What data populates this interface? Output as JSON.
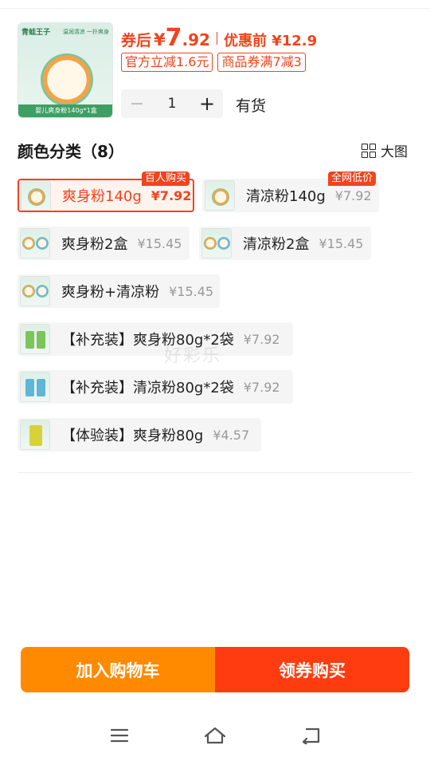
{
  "product": {
    "thumb_brand": "青蛙王子",
    "thumb_tag": "温润清凉 一扑爽身",
    "thumb_caption": "婴儿爽身粉140g*1盒",
    "after_coupon_label": "券后",
    "currency": "¥",
    "price_int": "7",
    "price_dec": ".92",
    "before_label": "优惠前 ¥12.9",
    "coupons": [
      "官方立减1.6元",
      "商品券满7减3"
    ],
    "quantity": "1",
    "stock": "有货"
  },
  "section": {
    "title": "颜色分类（8）",
    "view_label": "大图"
  },
  "options": [
    {
      "name": "爽身粉140g",
      "price": "¥7.92",
      "badge": "百人购买",
      "selected": true
    },
    {
      "name": "清凉粉140g",
      "price": "¥7.92",
      "badge": "全网低价",
      "selected": false
    },
    {
      "name": "爽身粉2盒",
      "price": "¥15.45",
      "badge": "",
      "selected": false
    },
    {
      "name": "清凉粉2盒",
      "price": "¥15.45",
      "badge": "",
      "selected": false
    },
    {
      "name": "爽身粉+清凉粉",
      "price": "¥15.45",
      "badge": "",
      "selected": false
    },
    {
      "name": "【补充装】爽身粉80g*2袋",
      "price": "¥7.92",
      "badge": "",
      "selected": false
    },
    {
      "name": "【补充装】清凉粉80g*2袋",
      "price": "¥7.92",
      "badge": "",
      "selected": false
    },
    {
      "name": "【体验装】爽身粉80g",
      "price": "¥4.57",
      "badge": "",
      "selected": false
    }
  ],
  "watermark": "好彩乐",
  "actions": {
    "add_to_cart": "加入购物车",
    "buy_with_coupon": "领券购买"
  },
  "icons": {
    "menu": "menu-icon",
    "home": "home-icon",
    "back": "back-icon",
    "grid": "grid-icon"
  },
  "colors": {
    "accent": "#f0441e",
    "cart": "#ff8a00",
    "buy": "#ff3c0f"
  }
}
